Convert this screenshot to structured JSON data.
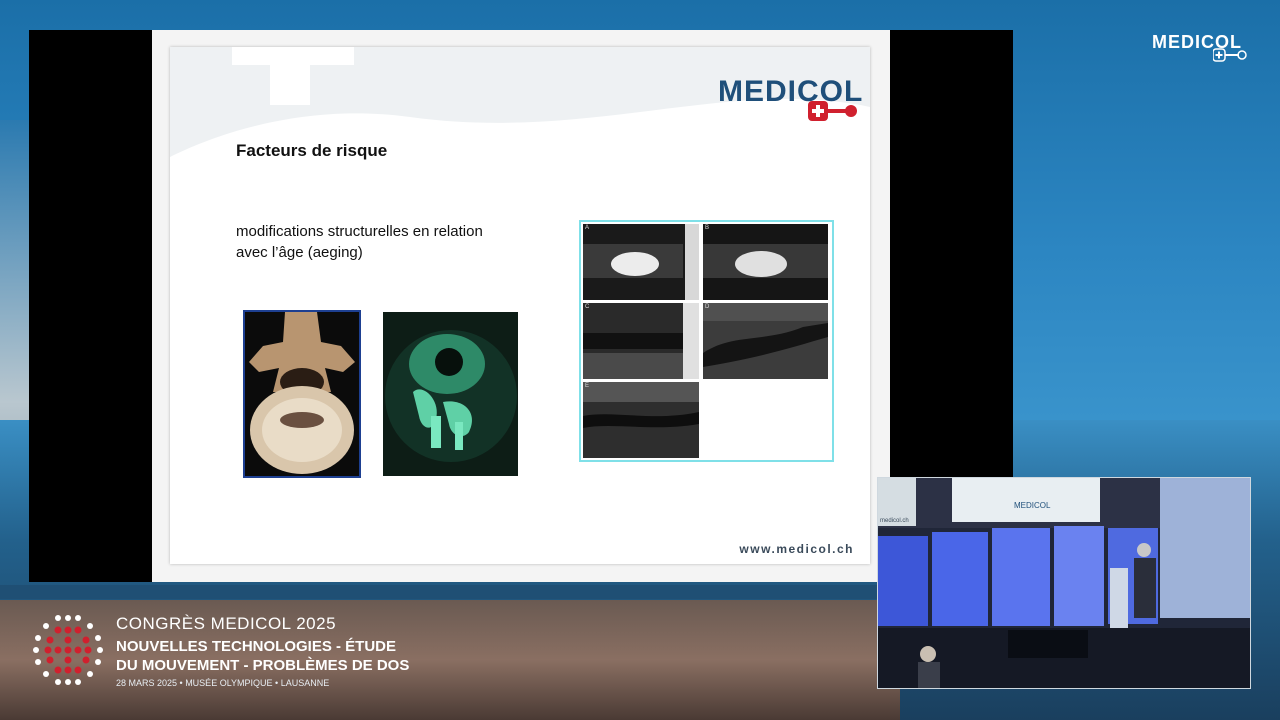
{
  "slide": {
    "logo_text": "MEDICOL",
    "title": "Facteurs de risque",
    "text_line1": "modifications structurelles en relation",
    "text_line2": "avec l’âge (aeging)",
    "url": "www.medicol.ch",
    "mri_labels": [
      "A",
      "B",
      "C",
      "D",
      "E"
    ]
  },
  "overlay": {
    "brand": "MEDICOL",
    "inset_slide_logo": "MEDICOL",
    "inset_slide_url": "medicol.ch"
  },
  "congress": {
    "title": "CONGRÈS MEDICOL 2025",
    "line1": "NOUVELLES TECHNOLOGIES - ÉTUDE",
    "line2": "DU MOUVEMENT - PROBLÈMES DE DOS",
    "date": "28 MARS 2025 • MUSÉE OLYMPIQUE • LAUSANNE"
  },
  "colors": {
    "brand_blue": "#1f4f7a",
    "brand_red": "#d0202e",
    "mri_border": "#7fe0e8",
    "spine_border": "#1d3f91"
  }
}
